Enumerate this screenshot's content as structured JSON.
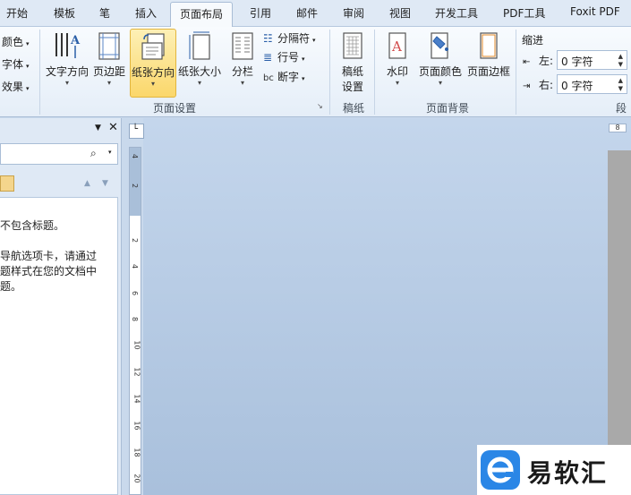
{
  "tabs": [
    {
      "label": "开始"
    },
    {
      "label": "模板"
    },
    {
      "label": "笔"
    },
    {
      "label": "插入"
    },
    {
      "label": "页面布局"
    },
    {
      "label": "引用"
    },
    {
      "label": "邮件"
    },
    {
      "label": "审阅"
    },
    {
      "label": "视图"
    },
    {
      "label": "开发工具"
    },
    {
      "label": "PDF工具"
    },
    {
      "label": "Foxit PDF"
    }
  ],
  "theme_group": {
    "colors": "颜色",
    "fonts": "字体",
    "effects": "效果"
  },
  "page_setup": {
    "text_direction": "文字方向",
    "margins": "页边距",
    "orientation": "纸张方向",
    "size": "纸张大小",
    "columns": "分栏",
    "breaks": "分隔符",
    "line_numbers": "行号",
    "hyphenation": "断字",
    "group_label": "页面设置"
  },
  "manuscript": {
    "label_line1": "稿纸",
    "label_line2": "设置",
    "group_label": "稿纸"
  },
  "page_background": {
    "watermark": "水印",
    "page_color": "页面颜色",
    "page_borders": "页面边框",
    "group_label": "页面背景"
  },
  "paragraph": {
    "indent_title": "缩进",
    "left_label": "左:",
    "left_value": "0 字符",
    "right_label": "右:",
    "right_value": "0 字符",
    "group_label": "段"
  },
  "nav_pane": {
    "line1": "不包含标题。",
    "line2": "导航选项卡，请通过",
    "line3": "题样式在您的文档中",
    "line4": "题。"
  },
  "ruler": {
    "ticks": [
      "4",
      "2",
      "2",
      "4",
      "6",
      "8",
      "10",
      "12",
      "14",
      "16",
      "18",
      "20"
    ],
    "h_mark": "8"
  },
  "watermark_brand": {
    "text": "易软汇"
  },
  "colors": {
    "accent": "#2a86e6",
    "selected": "#fbd76b"
  }
}
